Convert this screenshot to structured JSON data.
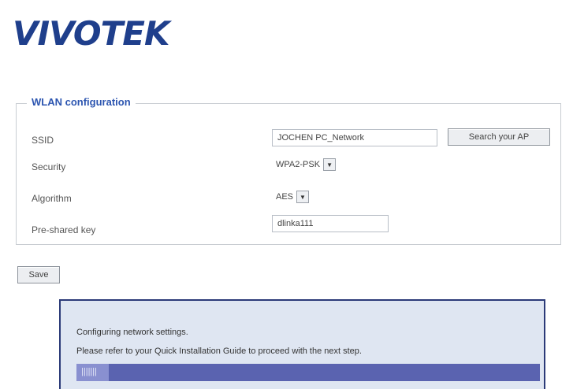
{
  "brand": {
    "logo_text": "VIVOTEK",
    "logo_sub": "",
    "logo_color": "#1f3f8c"
  },
  "wlan": {
    "legend": "WLAN configuration",
    "ssid_label": "SSID",
    "ssid_value": "JOCHEN PC_Network",
    "search_button": "Search your AP",
    "security_label": "Security",
    "security_value": "WPA2-PSK",
    "algorithm_label": "Algorithm",
    "algorithm_value": "AES",
    "psk_label": "Pre-shared key",
    "psk_value": "dlinka111"
  },
  "save_button": "Save",
  "status_panel": {
    "line1": "Configuring network settings.",
    "line2": "Please refer to your Quick Installation Guide to proceed with the next step.",
    "progress_text": "|||||||",
    "progress_fraction": 0.07,
    "panel_border_color": "#2b3a78",
    "progress_color": "#5a63b0"
  }
}
